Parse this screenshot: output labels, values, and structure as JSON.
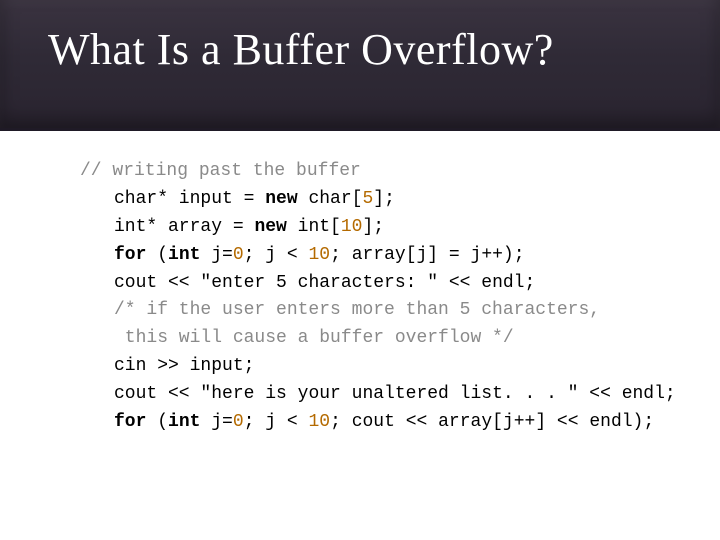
{
  "slide": {
    "title": "What Is a Buffer Overflow?"
  },
  "code": {
    "l1": "// writing past the buffer",
    "l2_a": "char* input = ",
    "l2_kw": "new ",
    "l2_b": "char[",
    "l2_n": "5",
    "l2_c": "];",
    "l3_a": "int* array = ",
    "l3_kw": "new ",
    "l3_b": "int[",
    "l3_n": "10",
    "l3_c": "];",
    "l4_kw1": "for ",
    "l4_a": "(",
    "l4_kw2": "int ",
    "l4_b": "j=",
    "l4_n0": "0",
    "l4_c": "; j < ",
    "l4_n1": "10",
    "l4_d": "; array[j] = j++);",
    "l5_a": "cout << ",
    "l5_s": "\"enter 5 characters: \"",
    "l5_b": " << endl;",
    "l6": "/* if the user enters more than 5 characters,",
    "l7": " this will cause a buffer overflow */",
    "l8": "cin >> input;",
    "l9_a": "cout << ",
    "l9_s": "\"here is your unaltered list. . . \"",
    "l9_b": " << endl;",
    "l10_kw1": "for ",
    "l10_a": "(",
    "l10_kw2": "int ",
    "l10_b": "j=",
    "l10_n0": "0",
    "l10_c": "; j < ",
    "l10_n1": "10",
    "l10_d": "; cout << array[j++] << endl);"
  }
}
